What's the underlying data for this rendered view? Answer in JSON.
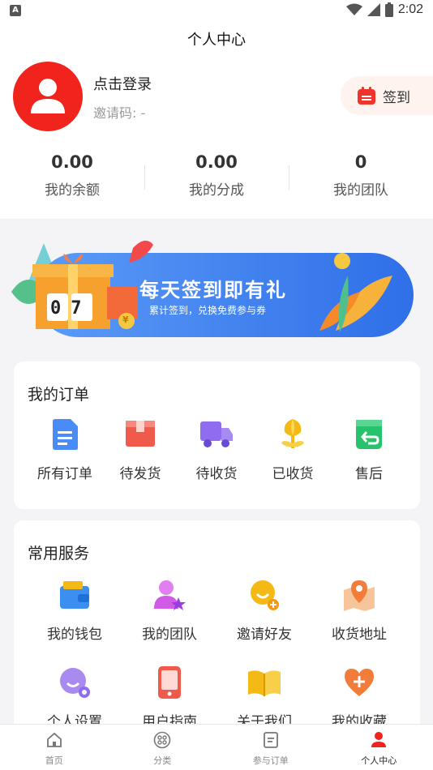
{
  "status": {
    "badge": "A",
    "time": "2:02"
  },
  "header": {
    "title": "个人中心"
  },
  "profile": {
    "login_text": "点击登录",
    "invite_text": "邀请码: -",
    "checkin_label": "签到"
  },
  "stats": [
    {
      "value": "0.00",
      "label": "我的余额"
    },
    {
      "value": "0.00",
      "label": "我的分成"
    },
    {
      "value": "0",
      "label": "我的团队"
    }
  ],
  "banner": {
    "title": "每天签到即有礼",
    "subtitle": "累计签到，兑换免费参与券",
    "counter": "07",
    "coin": "¥"
  },
  "orders": {
    "title": "我的订单",
    "items": [
      {
        "label": "所有订单",
        "icon": "document-icon",
        "color": "#4a8cf7"
      },
      {
        "label": "待发货",
        "icon": "package-icon",
        "color": "#f05a4a"
      },
      {
        "label": "待收货",
        "icon": "truck-icon",
        "color": "#8f6cf0"
      },
      {
        "label": "已收货",
        "icon": "flower-icon",
        "color": "#f5b915"
      },
      {
        "label": "售后",
        "icon": "return-icon",
        "color": "#27c26c"
      }
    ]
  },
  "services": {
    "title": "常用服务",
    "items": [
      {
        "label": "我的钱包",
        "icon": "wallet-icon"
      },
      {
        "label": "我的团队",
        "icon": "team-icon"
      },
      {
        "label": "邀请好友",
        "icon": "invite-icon"
      },
      {
        "label": "收货地址",
        "icon": "map-pin-icon"
      },
      {
        "label": "个人设置",
        "icon": "settings-icon"
      },
      {
        "label": "用户指南",
        "icon": "guide-icon"
      },
      {
        "label": "关于我们",
        "icon": "book-icon"
      },
      {
        "label": "我的收藏",
        "icon": "heart-icon"
      }
    ]
  },
  "tabbar": [
    {
      "label": "首页",
      "icon": "home-icon"
    },
    {
      "label": "分类",
      "icon": "category-icon"
    },
    {
      "label": "参与订单",
      "icon": "order-icon"
    },
    {
      "label": "个人中心",
      "icon": "user-icon",
      "active": true
    }
  ],
  "colors": {
    "accent": "#f0231d",
    "banner_blue": "#3a7df0"
  }
}
